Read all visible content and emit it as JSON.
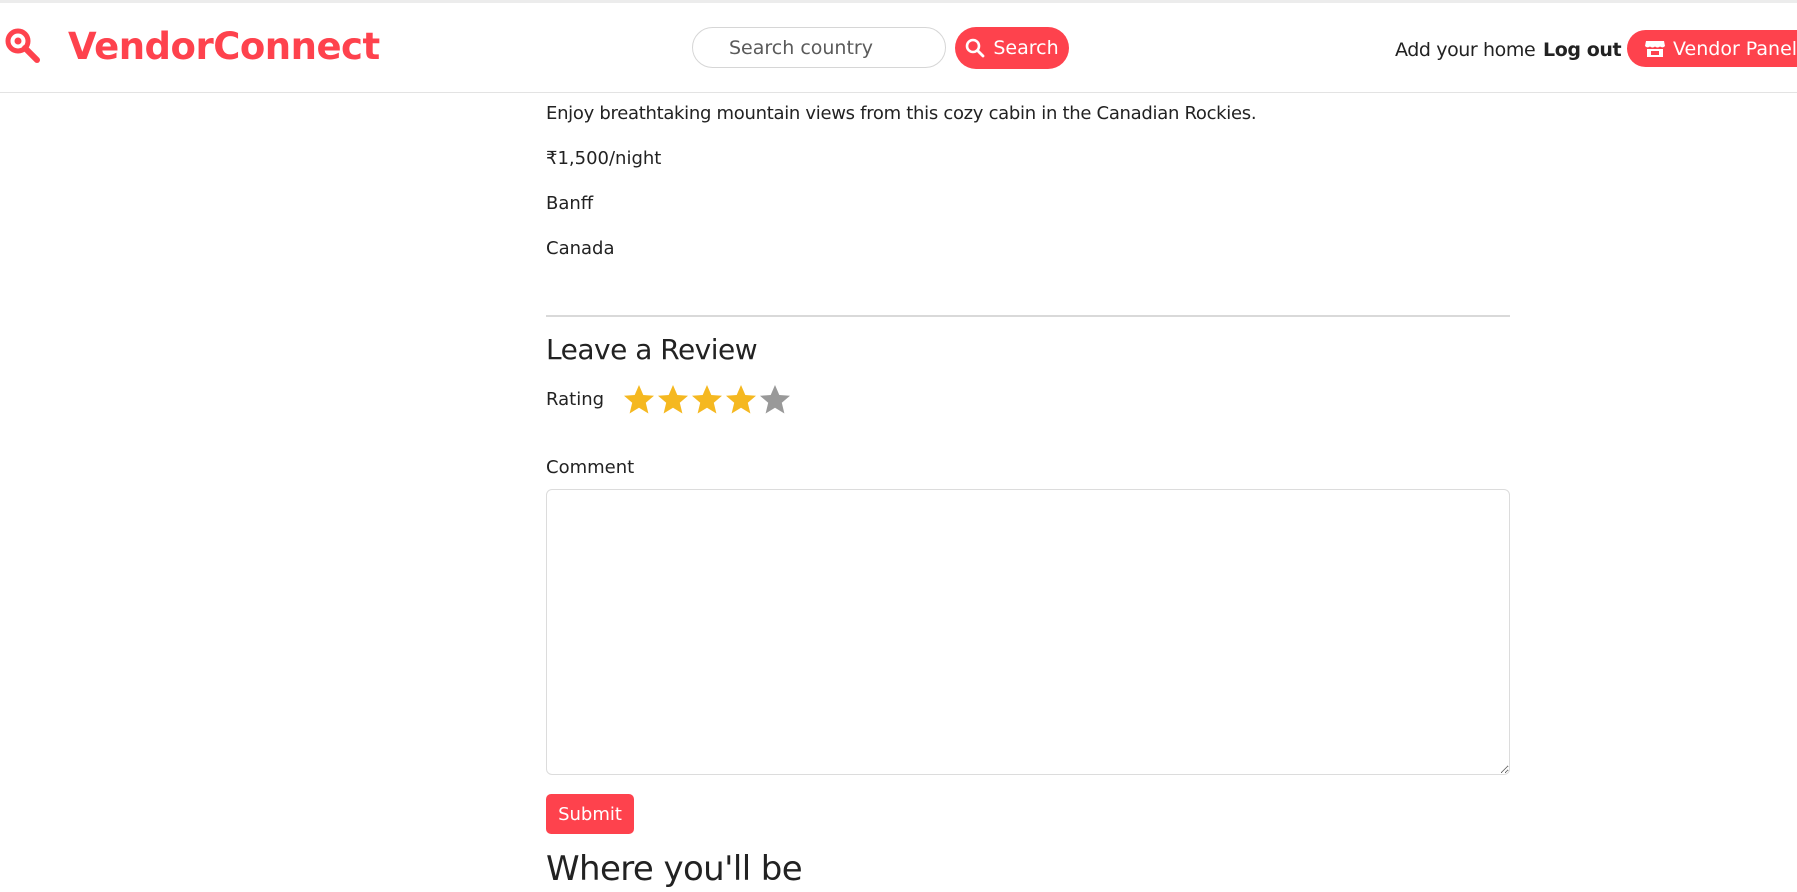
{
  "brand": {
    "name": "VendorConnect",
    "icon": "map-pin-search-icon",
    "color": "#fe424d"
  },
  "search": {
    "placeholder": "Search country",
    "button_label": "Search",
    "button_icon": "search-icon"
  },
  "nav": {
    "add_home": "Add your home",
    "logout": "Log out",
    "vendor_panel": "Vendor Panel",
    "vendor_icon": "store-icon"
  },
  "listing": {
    "description": "Enjoy breathtaking mountain views from this cozy cabin in the Canadian Rockies.",
    "price": "₹1,500/night",
    "city": "Banff",
    "country": "Canada"
  },
  "review": {
    "heading": "Leave a Review",
    "rating_label": "Rating",
    "rating_value": 4,
    "rating_max": 5,
    "star_filled_color": "#f5b820",
    "star_empty_color": "#999999",
    "comment_label": "Comment",
    "comment_value": "",
    "submit_label": "Submit"
  },
  "where_heading": "Where you'll be"
}
